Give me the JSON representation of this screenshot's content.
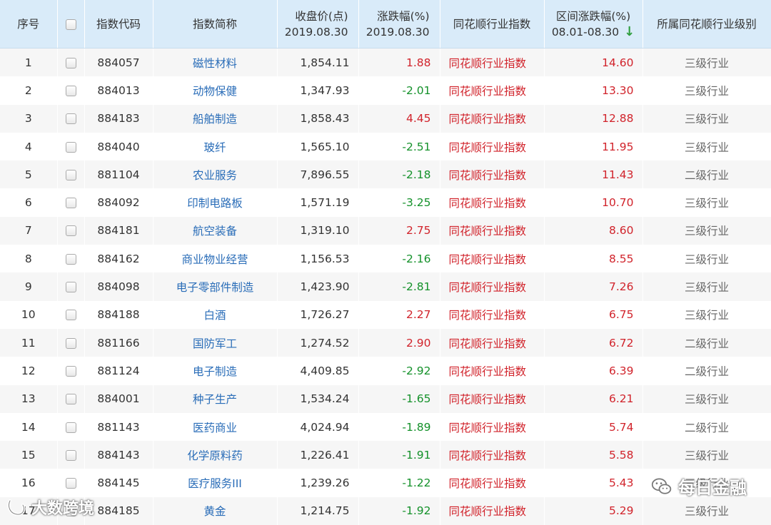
{
  "header": {
    "seq": "序号",
    "code": "指数代码",
    "name": "指数简称",
    "close_line1": "收盘价(点)",
    "close_line2": "2019.08.30",
    "chg_line1": "涨跌幅(%)",
    "chg_line2": "2019.08.30",
    "industry": "同花顺行业指数",
    "range_line1": "区间涨跌幅(%)",
    "range_line2": "08.01-08.30",
    "sort_arrow": "↓",
    "level": "所属同花顺行业级别"
  },
  "rows": [
    {
      "seq": "1",
      "code": "884057",
      "name": "磁性材料",
      "close": "1,854.11",
      "chg": "1.88",
      "dir": "up",
      "industry": "同花顺行业指数",
      "range": "14.60",
      "level": "三级行业"
    },
    {
      "seq": "2",
      "code": "884013",
      "name": "动物保健",
      "close": "1,347.93",
      "chg": "-2.01",
      "dir": "down",
      "industry": "同花顺行业指数",
      "range": "13.30",
      "level": "三级行业"
    },
    {
      "seq": "3",
      "code": "884183",
      "name": "船舶制造",
      "close": "1,858.43",
      "chg": "4.45",
      "dir": "up",
      "industry": "同花顺行业指数",
      "range": "12.88",
      "level": "三级行业"
    },
    {
      "seq": "4",
      "code": "884040",
      "name": "玻纤",
      "close": "1,565.10",
      "chg": "-2.51",
      "dir": "down",
      "industry": "同花顺行业指数",
      "range": "11.95",
      "level": "三级行业"
    },
    {
      "seq": "5",
      "code": "881104",
      "name": "农业服务",
      "close": "7,896.55",
      "chg": "-2.18",
      "dir": "down",
      "industry": "同花顺行业指数",
      "range": "11.43",
      "level": "二级行业"
    },
    {
      "seq": "6",
      "code": "884092",
      "name": "印制电路板",
      "close": "1,571.19",
      "chg": "-3.25",
      "dir": "down",
      "industry": "同花顺行业指数",
      "range": "10.70",
      "level": "三级行业"
    },
    {
      "seq": "7",
      "code": "884181",
      "name": "航空装备",
      "close": "1,319.10",
      "chg": "2.75",
      "dir": "up",
      "industry": "同花顺行业指数",
      "range": "8.60",
      "level": "三级行业"
    },
    {
      "seq": "8",
      "code": "884162",
      "name": "商业物业经营",
      "close": "1,156.53",
      "chg": "-2.16",
      "dir": "down",
      "industry": "同花顺行业指数",
      "range": "8.55",
      "level": "三级行业"
    },
    {
      "seq": "9",
      "code": "884098",
      "name": "电子零部件制造",
      "close": "1,423.90",
      "chg": "-2.81",
      "dir": "down",
      "industry": "同花顺行业指数",
      "range": "7.26",
      "level": "三级行业"
    },
    {
      "seq": "10",
      "code": "884188",
      "name": "白酒",
      "close": "1,726.27",
      "chg": "2.27",
      "dir": "up",
      "industry": "同花顺行业指数",
      "range": "6.75",
      "level": "三级行业"
    },
    {
      "seq": "11",
      "code": "881166",
      "name": "国防军工",
      "close": "1,274.52",
      "chg": "2.90",
      "dir": "up",
      "industry": "同花顺行业指数",
      "range": "6.72",
      "level": "二级行业"
    },
    {
      "seq": "12",
      "code": "881124",
      "name": "电子制造",
      "close": "4,409.85",
      "chg": "-2.92",
      "dir": "down",
      "industry": "同花顺行业指数",
      "range": "6.39",
      "level": "二级行业"
    },
    {
      "seq": "13",
      "code": "884001",
      "name": "种子生产",
      "close": "1,534.24",
      "chg": "-1.65",
      "dir": "down",
      "industry": "同花顺行业指数",
      "range": "6.21",
      "level": "三级行业"
    },
    {
      "seq": "14",
      "code": "881143",
      "name": "医药商业",
      "close": "4,024.94",
      "chg": "-1.89",
      "dir": "down",
      "industry": "同花顺行业指数",
      "range": "5.74",
      "level": "二级行业"
    },
    {
      "seq": "15",
      "code": "884143",
      "name": "化学原料药",
      "close": "1,226.41",
      "chg": "-1.91",
      "dir": "down",
      "industry": "同花顺行业指数",
      "range": "5.58",
      "level": "三级行业"
    },
    {
      "seq": "16",
      "code": "884145",
      "name": "医疗服务III",
      "close": "1,239.26",
      "chg": "-1.22",
      "dir": "down",
      "industry": "同花顺行业指数",
      "range": "5.43",
      "level": "三级行业"
    },
    {
      "seq": "17",
      "code": "884185",
      "name": "黄金",
      "close": "1,214.75",
      "chg": "-1.92",
      "dir": "down",
      "industry": "同花顺行业指数",
      "range": "5.29",
      "level": "三级行业"
    }
  ],
  "watermarks": {
    "left_text": "大数跨境",
    "right_text": "每日金融"
  },
  "icons": {
    "left_watermark": "logo-icon",
    "right_watermark": "wechat-icon",
    "row_checkbox": "checkbox-icon"
  },
  "colors": {
    "header_bg": "#d9ebf9",
    "stripe": "#f6f6f6",
    "up": "#d1232b",
    "down": "#14912a",
    "link": "#2a6db8",
    "sort_arrow": "#2f9e3e"
  }
}
